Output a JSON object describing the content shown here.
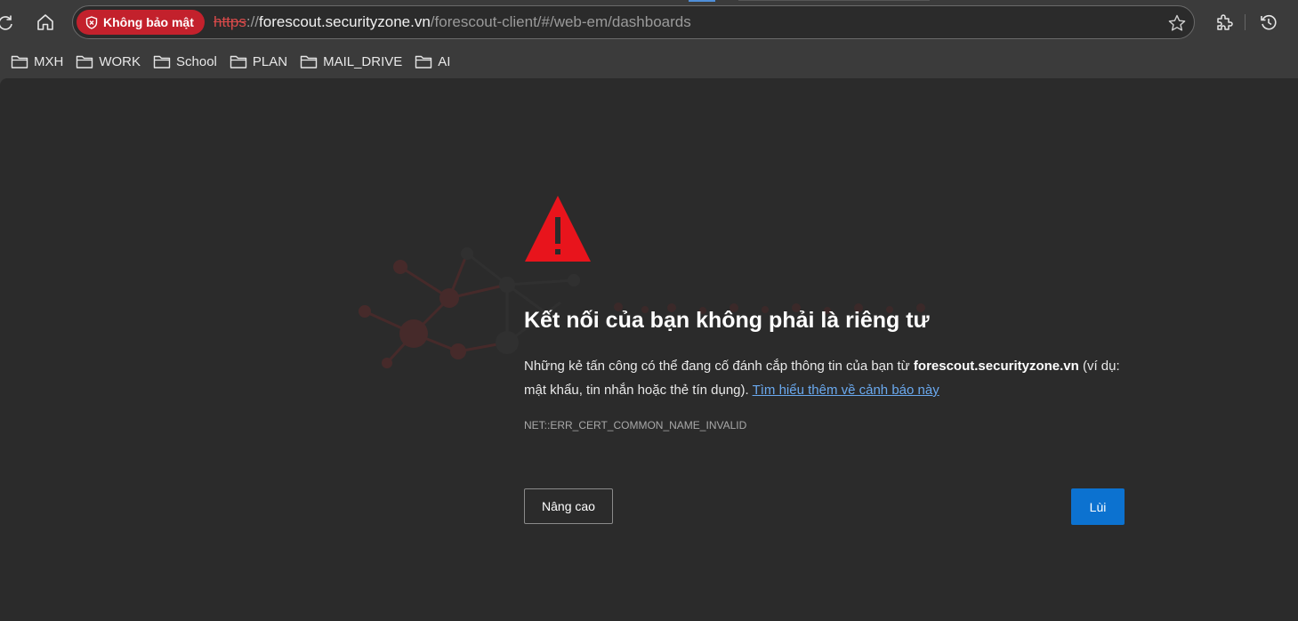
{
  "browser": {
    "security_badge": "Không bảo mật",
    "url": {
      "scheme": "https",
      "separator": "://",
      "host": "forescout.securityzone.vn",
      "path": "/forescout-client/#/web-em/dashboards"
    },
    "icons": {
      "reload": "reload-icon",
      "home": "home-icon",
      "star": "star-icon",
      "extensions": "extensions-icon",
      "history": "history-icon"
    },
    "colors": {
      "badge": "#c3212c",
      "link": "#6aa9ef",
      "primary_button": "#0c72d0",
      "warning": "#e8141c"
    }
  },
  "bookmarks": [
    {
      "label": "MXH"
    },
    {
      "label": "WORK"
    },
    {
      "label": "School"
    },
    {
      "label": "PLAN"
    },
    {
      "label": "MAIL_DRIVE"
    },
    {
      "label": "AI"
    }
  ],
  "error": {
    "title": "Kết nối của bạn không phải là riêng tư",
    "desc_before": "Những kẻ tấn công có thể đang cố đánh cắp thông tin của bạn từ ",
    "desc_host": "forescout.securityzone.vn",
    "desc_after": " (ví dụ: mật khẩu, tin nhắn hoặc thẻ tín dụng). ",
    "learn_more": "Tìm hiểu thêm về cảnh báo này",
    "code": "NET::ERR_CERT_COMMON_NAME_INVALID",
    "advanced_button": "Nâng cao",
    "back_button": "Lùi"
  }
}
